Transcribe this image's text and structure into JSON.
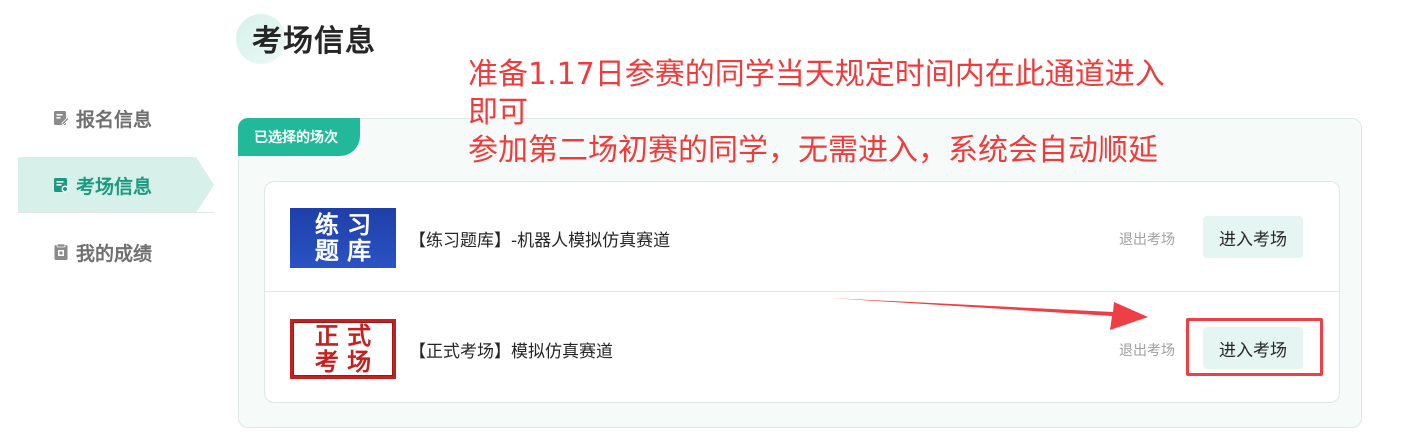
{
  "header": {
    "title": "考场信息"
  },
  "sidebar": {
    "items": [
      {
        "label": "报名信息",
        "icon": "edit-icon",
        "active": false
      },
      {
        "label": "考场信息",
        "icon": "venue-icon",
        "active": true
      },
      {
        "label": "我的成绩",
        "icon": "score-icon",
        "active": false
      }
    ]
  },
  "annotation": {
    "line1": "准备1.17日参赛的同学当天规定时间内在此通道进入",
    "line2": "即可",
    "line3": "参加第二场初赛的同学，无需进入，系统会自动顺延",
    "color": "#ef3b3b"
  },
  "panel": {
    "tag": "已选择的场次",
    "sessions": [
      {
        "thumb_line1": "练 习",
        "thumb_line2": "题 库",
        "label": "【练习题库】-机器人模拟仿真赛道",
        "exit_label": "退出考场",
        "enter_label": "进入考场"
      },
      {
        "thumb_line1": "正 式",
        "thumb_line2": "考 场",
        "label": "【正式考场】模拟仿真赛道",
        "exit_label": "退出考场",
        "enter_label": "进入考场"
      }
    ]
  },
  "colors": {
    "accent": "#22b99a",
    "highlight": "#ee3f46"
  }
}
